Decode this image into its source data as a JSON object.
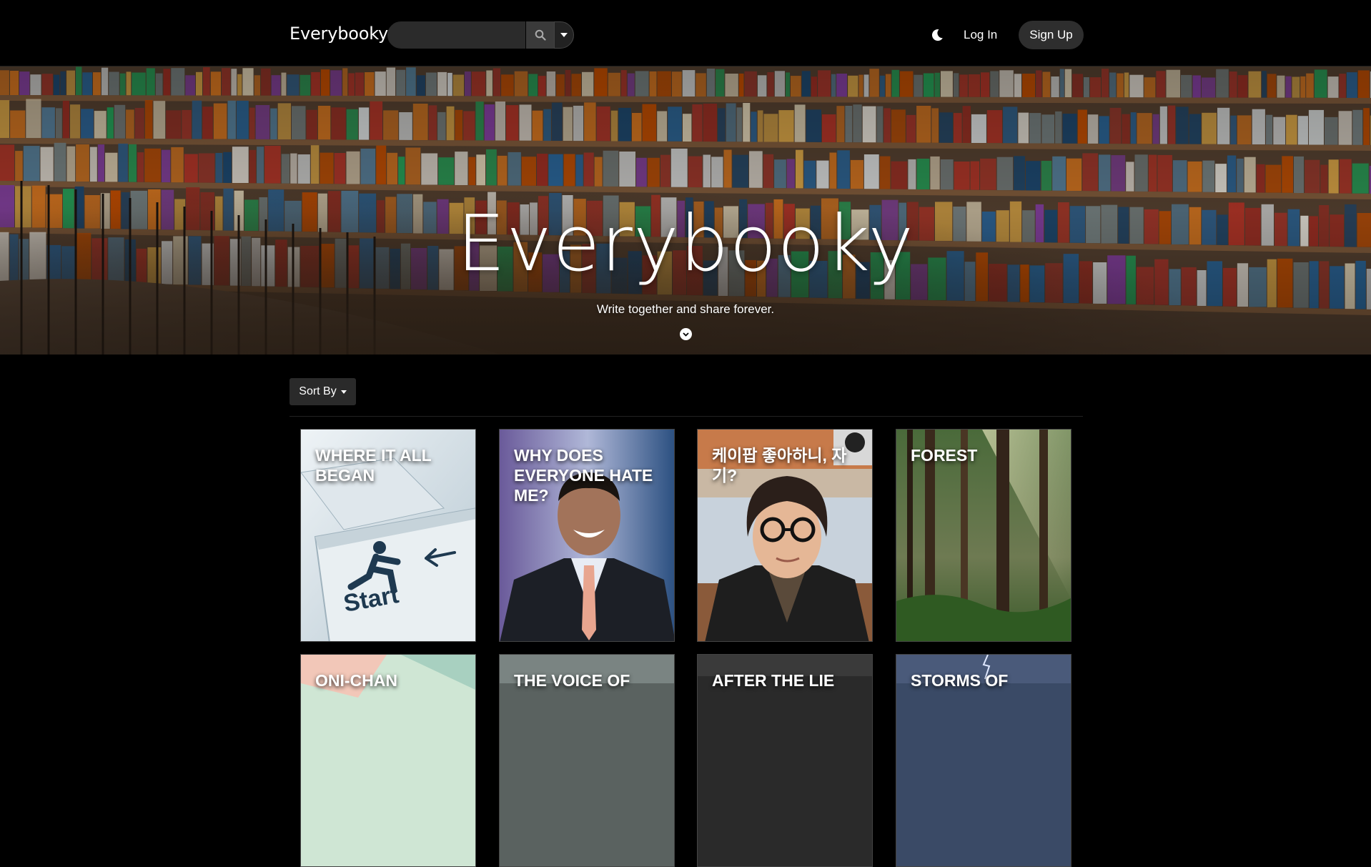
{
  "navbar": {
    "brand": "Everybooky",
    "search": {
      "placeholder": "",
      "value": ""
    },
    "icons": [
      "search-icon",
      "caret-down-icon",
      "moon-icon"
    ],
    "login_label": "Log In",
    "signup_label": "Sign Up"
  },
  "hero": {
    "title": "Everybooky",
    "subtitle": "Write together and share forever.",
    "icon": "chevron-down-circle-icon"
  },
  "toolbar": {
    "sort_label": "Sort By"
  },
  "books": [
    {
      "title": "Where it all began",
      "image": "start-key"
    },
    {
      "title": "Why does everyone hate me?",
      "image": "man-in-suit"
    },
    {
      "title": "케이팝 좋아하니, 자기?",
      "image": "man-with-glasses"
    },
    {
      "title": "Forest",
      "image": "forest"
    },
    {
      "title": "Oni-Chan",
      "image": "anime"
    },
    {
      "title": "The Voice of",
      "image": "dark-gray"
    },
    {
      "title": "After the Lie",
      "image": "dark"
    },
    {
      "title": "Storms of",
      "image": "storm"
    }
  ],
  "colors": {
    "background": "#000000",
    "nav_control": "#2e2e2e",
    "text": "#ffffff"
  }
}
